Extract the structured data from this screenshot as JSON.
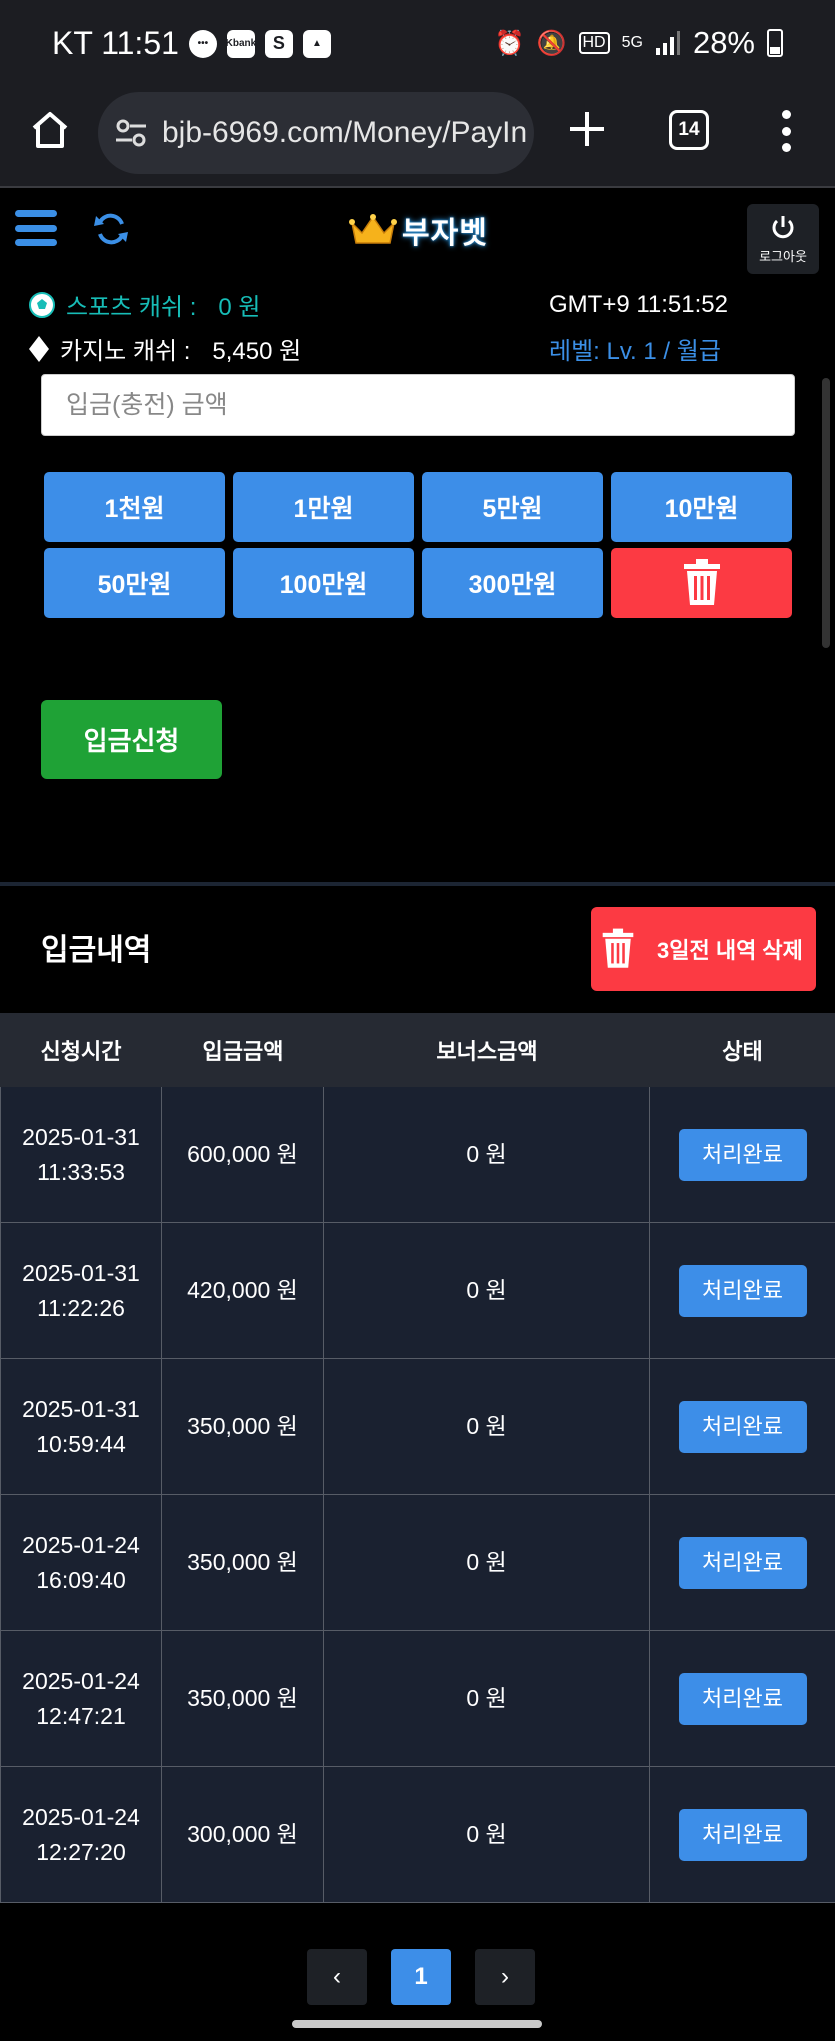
{
  "status_bar": {
    "carrier_time": "KT 11:51",
    "app_icons": [
      "chat-icon",
      "kbank-icon",
      "s-icon",
      "gallery-icon"
    ],
    "kbank_label": "Kbank",
    "s_label": "S",
    "hd_label": "HD",
    "network_label": "5G",
    "battery_pct": "28%"
  },
  "browser": {
    "url": "bjb-6969.com/Money/PayIn",
    "tab_count": "14"
  },
  "header": {
    "logo_text": "부자벳",
    "logout_label": "로그아웃"
  },
  "balance": {
    "sports_label": "스포츠 캐쉬 :",
    "sports_value": "0 원",
    "casino_label": "카지노 캐쉬 :",
    "casino_value": "5,450 원",
    "clock": "GMT+9 11:51:52",
    "level": "레벨: Lv. 1 / 월급"
  },
  "deposit_form": {
    "amount_placeholder": "입금(충전) 금액",
    "amount_buttons": [
      "1천원",
      "1만원",
      "5만원",
      "10만원",
      "50만원",
      "100만원",
      "300만원"
    ],
    "submit_label": "입금신청"
  },
  "history": {
    "title": "입금내역",
    "delete_label": "3일전 내역 삭제",
    "columns": [
      "신청시간",
      "입금금액",
      "보너스금액",
      "상태"
    ],
    "rows": [
      {
        "date": "2025-01-31",
        "time": "11:33:53",
        "amount": "600,000 원",
        "bonus": "0 원",
        "status": "처리완료"
      },
      {
        "date": "2025-01-31",
        "time": "11:22:26",
        "amount": "420,000 원",
        "bonus": "0 원",
        "status": "처리완료"
      },
      {
        "date": "2025-01-31",
        "time": "10:59:44",
        "amount": "350,000 원",
        "bonus": "0 원",
        "status": "처리완료"
      },
      {
        "date": "2025-01-24",
        "time": "16:09:40",
        "amount": "350,000 원",
        "bonus": "0 원",
        "status": "처리완료"
      },
      {
        "date": "2025-01-24",
        "time": "12:47:21",
        "amount": "350,000 원",
        "bonus": "0 원",
        "status": "처리완료"
      },
      {
        "date": "2025-01-24",
        "time": "12:27:20",
        "amount": "300,000 원",
        "bonus": "0 원",
        "status": "처리완료"
      }
    ]
  },
  "pagination": {
    "prev": "‹",
    "current": "1",
    "next": "›"
  },
  "colors": {
    "accent_blue": "#3d8ee8",
    "danger_red": "#fc3a43",
    "success_green": "#1fa236",
    "teal": "#17bdb7"
  }
}
